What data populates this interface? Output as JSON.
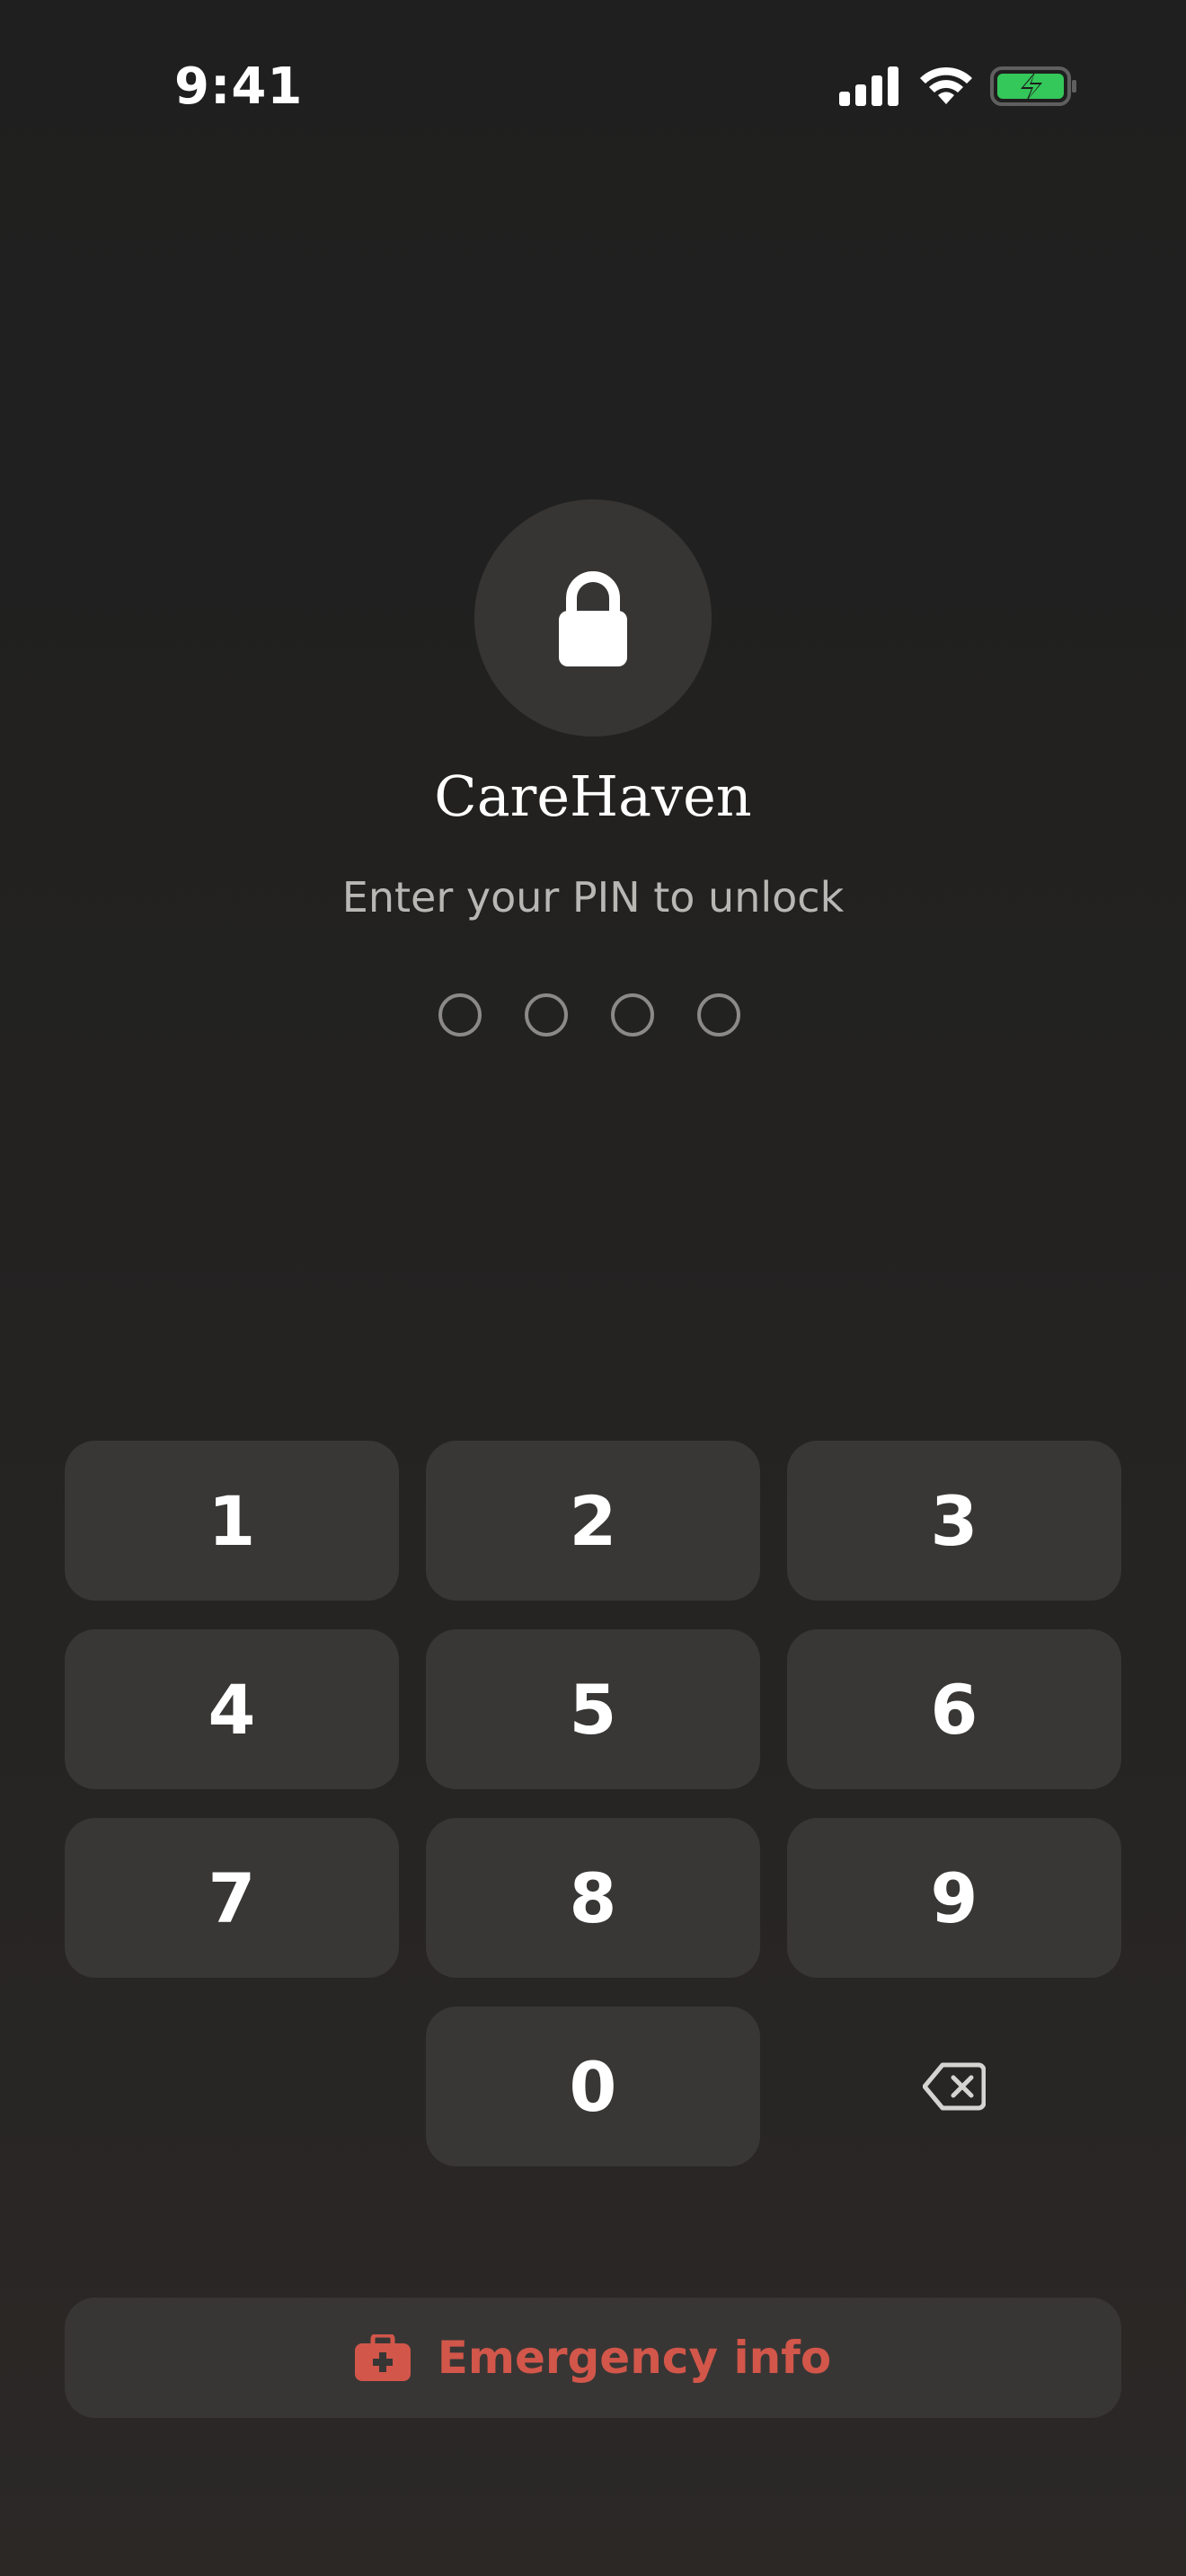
{
  "status_bar": {
    "time": "9:41",
    "icons": [
      "cellular-signal-icon",
      "wifi-icon",
      "battery-charging-icon"
    ],
    "battery_color": "#34c759"
  },
  "lock_screen": {
    "icon": "lock-icon",
    "title": "CareHaven",
    "subtitle": "Enter your PIN to unlock",
    "pin_length": 4,
    "pin_entered": 0
  },
  "keypad": {
    "keys": [
      "1",
      "2",
      "3",
      "4",
      "5",
      "6",
      "7",
      "8",
      "9",
      "0"
    ],
    "delete_icon": "backspace-icon"
  },
  "emergency": {
    "label": "Emergency info",
    "icon": "medical-kit-icon",
    "color": "#d2564a"
  }
}
